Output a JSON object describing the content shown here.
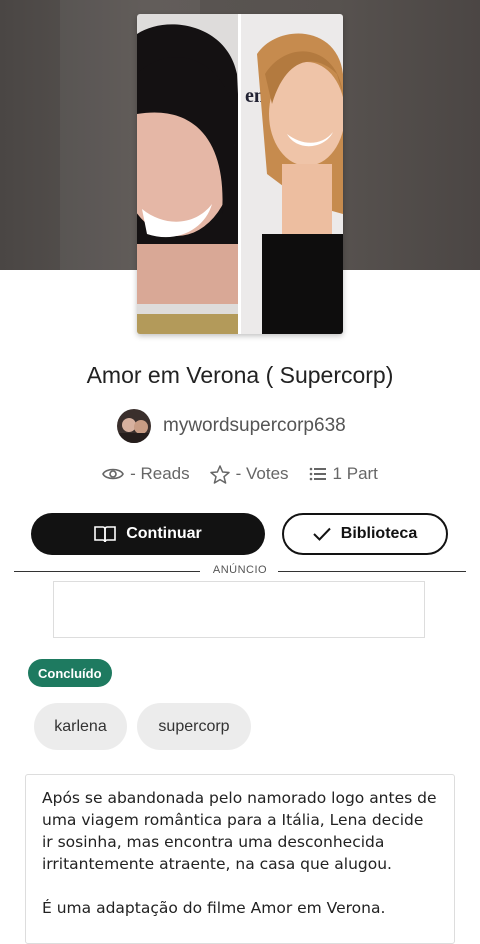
{
  "story": {
    "title": "Amor em Verona ( Supercorp)",
    "author": "mywordsupercorp638",
    "cover_image_alt": "Cover image"
  },
  "stats": {
    "reads": "- Reads",
    "votes": "- Votes",
    "parts": "1 Part"
  },
  "actions": {
    "continue_label": "Continuar",
    "library_label": "Biblioteca"
  },
  "ad": {
    "label": "ANÚNCIO"
  },
  "status_badge": "Concluído",
  "tags": [
    "karlena",
    "supercorp"
  ],
  "description": {
    "paragraph1": "Após se abandonada pelo namorado logo antes de uma viagem romântica para a Itália, Lena decide ir sosinha, mas encontra uma desconhecida irritantemente atraente, na casa que alugou.",
    "paragraph2": "É uma adaptação do filme Amor em Verona."
  },
  "colors": {
    "primary_button": "#121212",
    "badge": "#1e7a60",
    "tag_bg": "#ececec"
  }
}
